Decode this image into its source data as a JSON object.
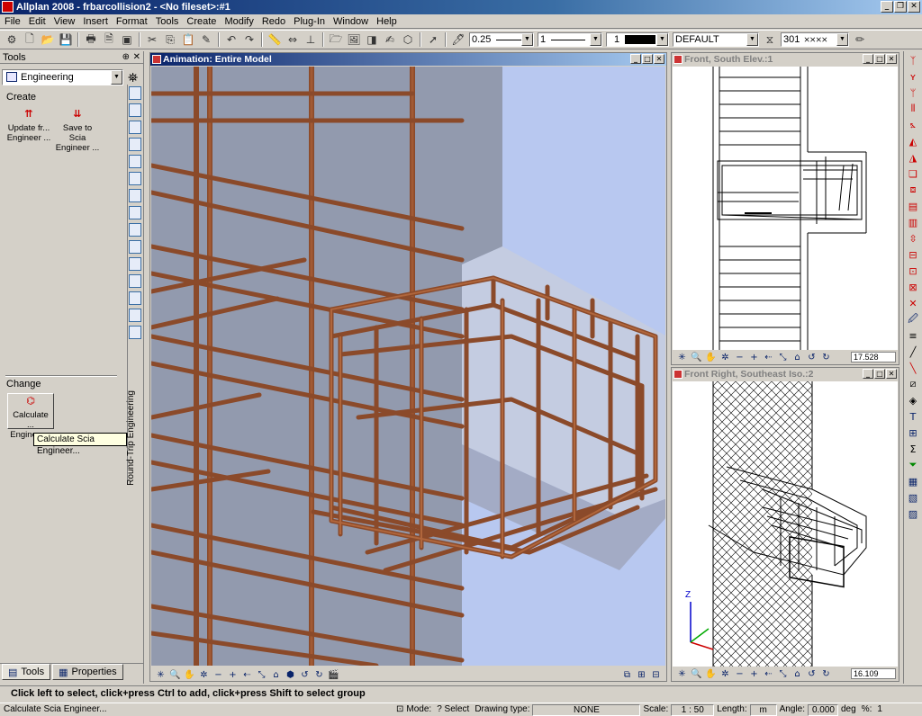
{
  "window": {
    "title": "Allplan 2008 - frbarcollision2 - <No fileset>:#1"
  },
  "menu": [
    "File",
    "Edit",
    "View",
    "Insert",
    "Format",
    "Tools",
    "Create",
    "Modify",
    "Redo",
    "Plug-In",
    "Window",
    "Help"
  ],
  "toolbar": {
    "pen_thickness": "0.25",
    "line_type": "1",
    "color_number": "1",
    "layer": "DEFAULT",
    "pattern": "301"
  },
  "tools_panel": {
    "title": "Tools",
    "module": "Engineering",
    "create_label": "Create",
    "create_tools": [
      {
        "label": "Update fr... Engineer ..."
      },
      {
        "label": "Save to Scia Engineer ..."
      }
    ],
    "change_label": "Change",
    "change_tool": "Calculate ... Engineer...",
    "vertical_tab": "Round-Trip Engineering",
    "tooltip": "Calculate Scia Engineer...",
    "tabs": [
      "Tools",
      "Properties"
    ]
  },
  "viewports": {
    "main": {
      "title": "Animation: Entire Model"
    },
    "top_right": {
      "title": "Front, South Elev.:1",
      "scale": "17.528"
    },
    "bottom_right": {
      "title": "Front Right, Southeast Iso.:2",
      "scale": "16.109",
      "axis_label": "Z"
    }
  },
  "dialog_line": "Click left to select, click+press Ctrl to add, click+press Shift to select group",
  "statusbar": {
    "message": "Calculate Scia Engineer...",
    "mode_label": "Mode:",
    "mode_value": "? Select",
    "drawing_type_label": "Drawing type:",
    "drawing_type_value": "NONE",
    "scale_label": "Scale:",
    "scale_value": "1 : 50",
    "length_label": "Length:",
    "length_value": "m",
    "angle_label": "Angle:",
    "angle_value": "0.000",
    "angle_unit": "deg",
    "percent_label": "%:",
    "percent_value": "1"
  },
  "colors": {
    "rebar": "#8b4a2a",
    "background3d": "#b8c8f0",
    "accent": "#0a246a"
  }
}
